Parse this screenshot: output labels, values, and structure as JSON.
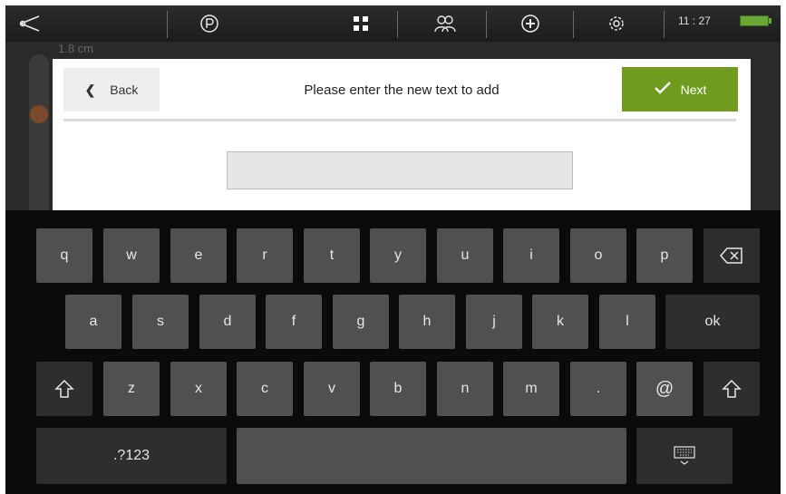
{
  "topbar": {
    "clock": "11 : 27",
    "icons": [
      "scissors-icon",
      "parking-icon",
      "grid-icon",
      "people-icon",
      "add-circle-icon",
      "gear-icon",
      "battery-icon"
    ]
  },
  "background_app": {
    "label": "1.8 cm"
  },
  "dialog": {
    "back_label": "Back",
    "title": "Please enter the new text to add",
    "next_label": "Next",
    "input_value": "",
    "accent_color": "#6f9c1f"
  },
  "keyboard": {
    "row1": [
      "q",
      "w",
      "e",
      "r",
      "t",
      "y",
      "u",
      "i",
      "o",
      "p"
    ],
    "row2": [
      "a",
      "s",
      "d",
      "f",
      "g",
      "h",
      "j",
      "k",
      "l"
    ],
    "row2_ok": "ok",
    "row3": [
      "z",
      "x",
      "c",
      "v",
      "b",
      "n",
      "m",
      "."
    ],
    "at_key": "@",
    "numbers_key": ".?123",
    "space_key": ""
  }
}
